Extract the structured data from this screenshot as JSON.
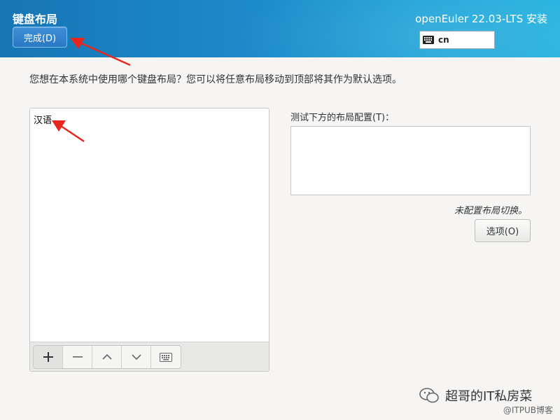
{
  "header": {
    "page_title": "键盘布局",
    "done_label": "完成(D)",
    "product_title": "openEuler 22.03-LTS 安装",
    "keyboard_indicator": "cn"
  },
  "main": {
    "instruction": "您想在本系统中使用哪个键盘布局？您可以将任意布局移动到顶部将其作为默认选项。",
    "layouts": [
      "汉语"
    ],
    "toolbar_icons": [
      "plus-icon",
      "minus-icon",
      "chevron-up-icon",
      "chevron-down-icon",
      "keyboard-icon"
    ],
    "test_label": "测试下方的布局配置(T)：",
    "test_value": "",
    "switch_status": "未配置布局切换。",
    "options_label": "选项(O)"
  },
  "watermark": {
    "channel": "超哥的IT私房菜",
    "source": "@ITPUB博客"
  },
  "colors": {
    "header_start": "#1775b5",
    "header_end": "#27b3df",
    "accent_button": "#2a78c4",
    "annotation_arrow": "#e8261c"
  }
}
